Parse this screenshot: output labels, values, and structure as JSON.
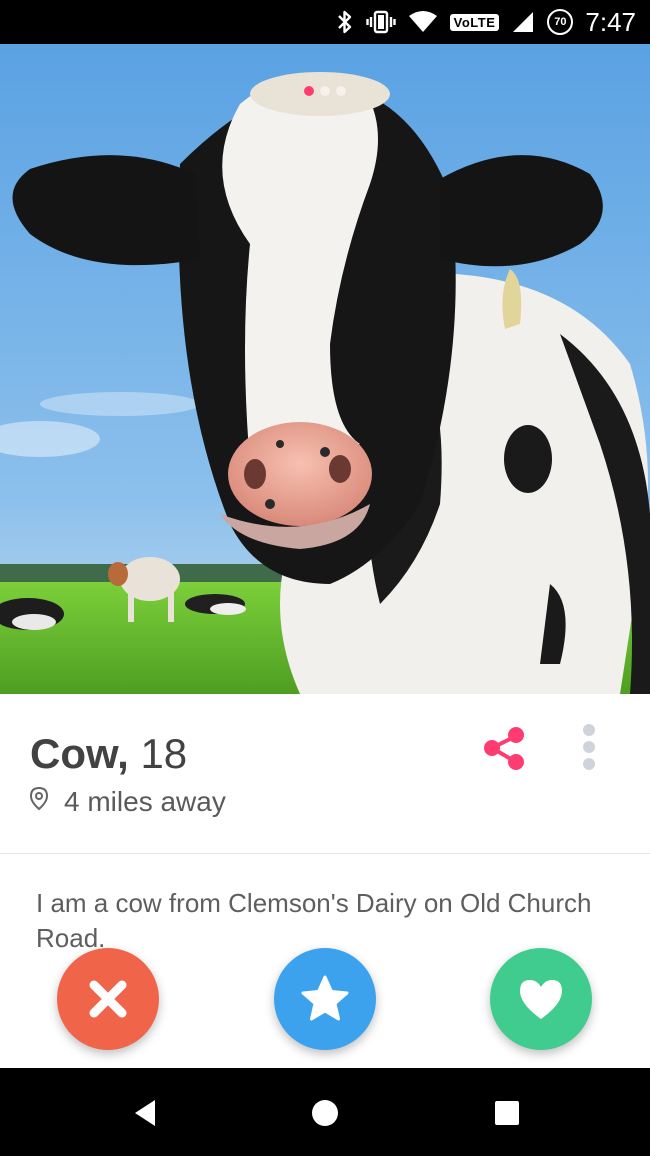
{
  "status_bar": {
    "volte_label": "VoLTE",
    "battery_level": "70",
    "time": "7:47",
    "icons": [
      "bluetooth-icon",
      "vibrate-icon",
      "wifi-icon",
      "signal-icon",
      "battery-icon"
    ]
  },
  "photo": {
    "subject": "cow-photo",
    "dot_count": 3,
    "active_dot": 0
  },
  "profile": {
    "name": "Cow,",
    "age": "18",
    "distance": "4 miles away",
    "bio": "I am a cow from Clemson's Dairy on Old Church Road."
  },
  "actions": {
    "nope_icon": "x-icon",
    "super_like_icon": "star-icon",
    "like_icon": "heart-icon"
  },
  "colors": {
    "brand": "#fe3c72",
    "nope": "#f0654a",
    "super_like": "#3da2ee",
    "like": "#3fcc8e"
  },
  "nav_bar": {
    "icons": [
      "back-icon",
      "home-icon",
      "recents-icon"
    ]
  }
}
